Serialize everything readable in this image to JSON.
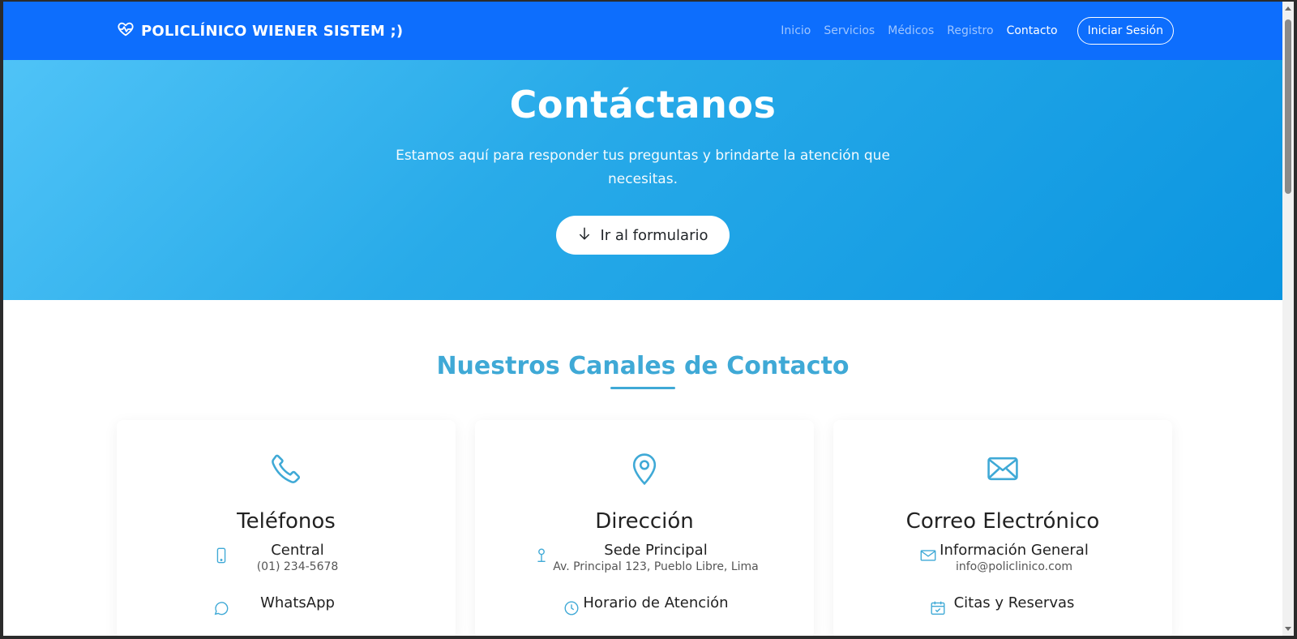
{
  "navbar": {
    "brand": "POLICLÍNICO WIENER SISTEM ;)",
    "links": [
      {
        "label": "Inicio"
      },
      {
        "label": "Servicios"
      },
      {
        "label": "Médicos"
      },
      {
        "label": "Registro"
      },
      {
        "label": "Contacto"
      }
    ],
    "login_label": "Iniciar Sesión"
  },
  "hero": {
    "title": "Contáctanos",
    "subtitle": "Estamos aquí para responder tus preguntas y brindarte la atención que necesitas.",
    "button_label": "Ir al formulario"
  },
  "section": {
    "title": "Nuestros Canales de Contacto",
    "cards": [
      {
        "icon": "phone-icon",
        "title": "Teléfonos",
        "items": [
          {
            "icon": "mobile-icon",
            "label": "Central",
            "value": "(01) 234-5678"
          },
          {
            "icon": "whatsapp-icon",
            "label": "WhatsApp",
            "value": ""
          }
        ]
      },
      {
        "icon": "map-pin-icon",
        "title": "Dirección",
        "items": [
          {
            "icon": "pin-icon",
            "label": "Sede Principal",
            "value": "Av. Principal 123, Pueblo Libre, Lima"
          },
          {
            "icon": "clock-icon",
            "label": "Horario de Atención",
            "value": ""
          }
        ]
      },
      {
        "icon": "envelope-icon",
        "title": "Correo Electrónico",
        "items": [
          {
            "icon": "envelope-small-icon",
            "label": "Información General",
            "value": "info@policlinico.com"
          },
          {
            "icon": "calendar-check-icon",
            "label": "Citas y Reservas",
            "value": ""
          }
        ]
      }
    ]
  },
  "colors": {
    "navbar": "#0d6efd",
    "accent": "#3fa9d6",
    "hero_start": "#4fc3f7",
    "hero_end": "#0b95e0"
  }
}
